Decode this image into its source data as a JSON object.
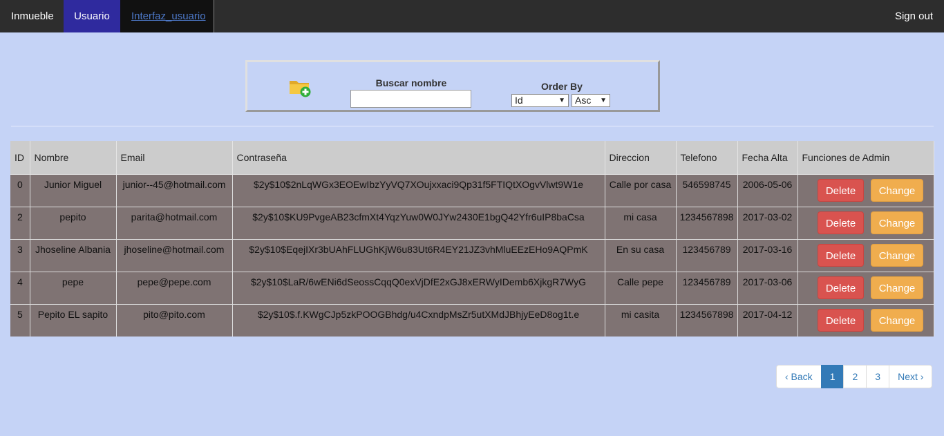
{
  "navbar": {
    "items": [
      {
        "label": "Inmueble"
      },
      {
        "label": "Usuario"
      },
      {
        "label": "Interfaz_usuario"
      }
    ],
    "signout_label": "Sign out"
  },
  "search": {
    "buscar_label": "Buscar nombre",
    "input_value": "",
    "order_label": "Order By",
    "order_field": "Id",
    "order_dir": "Asc"
  },
  "table": {
    "headers": [
      "ID",
      "Nombre",
      "Email",
      "Contraseña",
      "Direccion",
      "Telefono",
      "Fecha Alta",
      "Funciones de Admin"
    ],
    "rows": [
      {
        "id": "0",
        "nombre": "Junior Miguel",
        "email": "junior--45@hotmail.com",
        "password": "$2y$10$2nLqWGx3EOEwIbzYyVQ7XOujxxaci9Qp31f5FTIQtXOgvVlwt9W1e",
        "direccion": "Calle por casa",
        "telefono": "546598745",
        "fecha": "2006-05-06"
      },
      {
        "id": "2",
        "nombre": "pepito",
        "email": "parita@hotmail.com",
        "password": "$2y$10$KU9PvgeAB23cfmXt4YqzYuw0W0JYw2430E1bgQ42Yfr6uIP8baCsa",
        "direccion": "mi casa",
        "telefono": "1234567898",
        "fecha": "2017-03-02"
      },
      {
        "id": "3",
        "nombre": "Jhoseline Albania",
        "email": "jhoseline@hotmail.com",
        "password": "$2y$10$EqejIXr3bUAhFLUGhKjW6u83Ut6R4EY21JZ3vhMluEEzEHo9AQPmK",
        "direccion": "En su casa",
        "telefono": "123456789",
        "fecha": "2017-03-16"
      },
      {
        "id": "4",
        "nombre": "pepe",
        "email": "pepe@pepe.com",
        "password": "$2y$10$LaR/6wENi6dSeossCqqQ0exVjDfE2xGJ8xERWyIDemb6XjkgR7WyG",
        "direccion": "Calle pepe",
        "telefono": "123456789",
        "fecha": "2017-03-06"
      },
      {
        "id": "5",
        "nombre": "Pepito EL sapito",
        "email": "pito@pito.com",
        "password": "$2y$10$.f.KWgCJp5zkPOOGBhdg/u4CxndpMsZr5utXMdJBhjyEeD8og1t.e",
        "direccion": "mi casita",
        "telefono": "1234567898",
        "fecha": "2017-04-12"
      }
    ],
    "delete_label": "Delete",
    "change_label": "Change"
  },
  "pagination": {
    "back_label": "‹ Back",
    "pages": [
      "1",
      "2",
      "3"
    ],
    "active_page": "1",
    "next_label": "Next ›"
  },
  "colors": {
    "background": "#c5d3f6",
    "navbar": "#2d2d2d",
    "nav_active": "#2f2a9e",
    "row_bg": "#7f7373",
    "delete": "#d9534f",
    "change": "#f0ad4e",
    "page_active": "#337ab7"
  },
  "icons": {
    "add_folder": "folder-add-icon",
    "select_arrow": "chevron-down-icon"
  }
}
